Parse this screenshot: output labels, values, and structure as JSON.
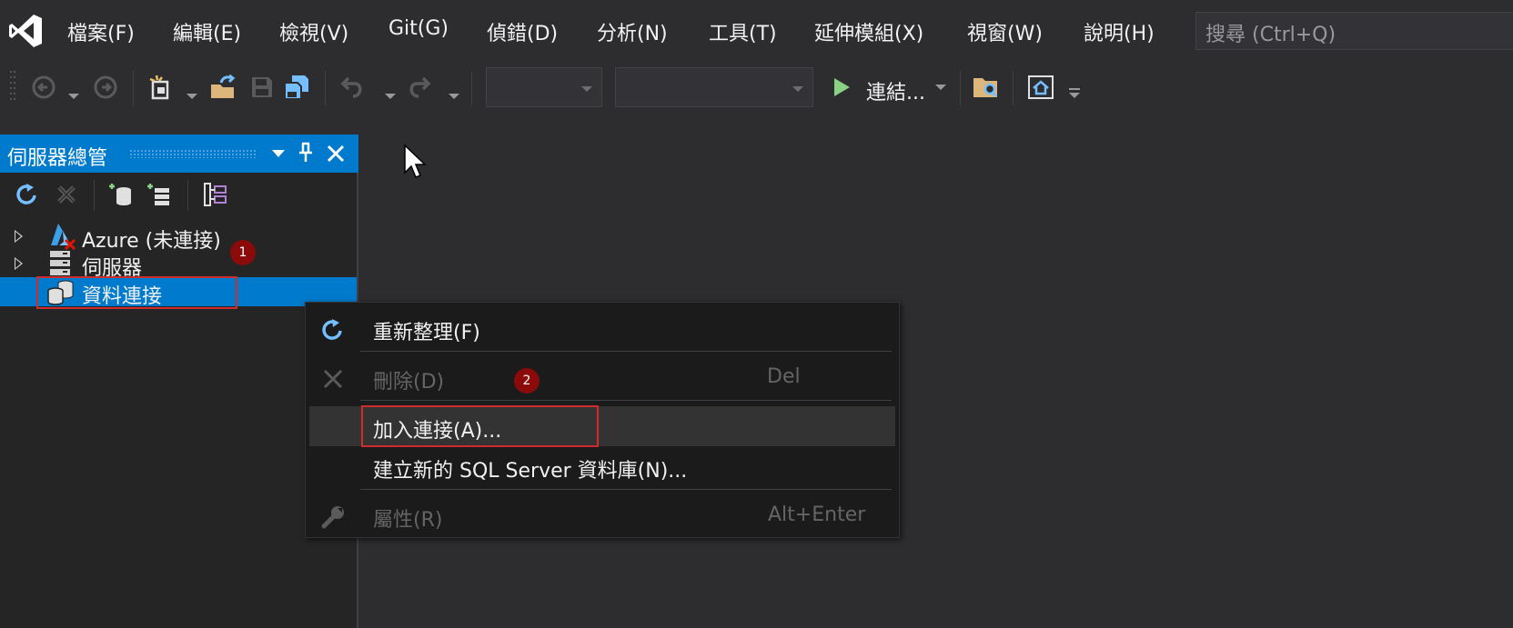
{
  "menubar": {
    "items": [
      "檔案(F)",
      "編輯(E)",
      "檢視(V)",
      "Git(G)",
      "偵錯(D)",
      "分析(N)",
      "工具(T)",
      "延伸模組(X)",
      "視窗(W)",
      "說明(H)"
    ],
    "search_placeholder": "搜尋 (Ctrl+Q)"
  },
  "toolbar": {
    "connect_label": "連結..."
  },
  "server_explorer": {
    "title": "伺服器總管",
    "tree": [
      {
        "label": "Azure (未連接)",
        "icon": "azure-icon",
        "expandable": true
      },
      {
        "label": "伺服器",
        "icon": "server-icon",
        "expandable": true
      },
      {
        "label": "資料連接",
        "icon": "data-connections-icon",
        "expandable": false,
        "selected": true
      }
    ]
  },
  "context_menu": {
    "items": [
      {
        "label": "重新整理(F)",
        "icon": "refresh-icon",
        "shortcut": "",
        "enabled": true
      },
      {
        "label": "刪除(D)",
        "icon": "delete-icon",
        "shortcut": "Del",
        "enabled": false
      },
      {
        "label": "加入連接(A)...",
        "icon": "",
        "shortcut": "",
        "enabled": true,
        "hovered": true
      },
      {
        "label": "建立新的 SQL Server 資料庫(N)...",
        "icon": "",
        "shortcut": "",
        "enabled": true
      },
      {
        "label": "屬性(R)",
        "icon": "wrench-icon",
        "shortcut": "Alt+Enter",
        "enabled": false
      }
    ]
  },
  "annotations": {
    "step1": "1",
    "step2": "2"
  },
  "colors": {
    "accent": "#007acc",
    "callout": "#8b0a0a",
    "highlight_box": "#d22b2b"
  }
}
